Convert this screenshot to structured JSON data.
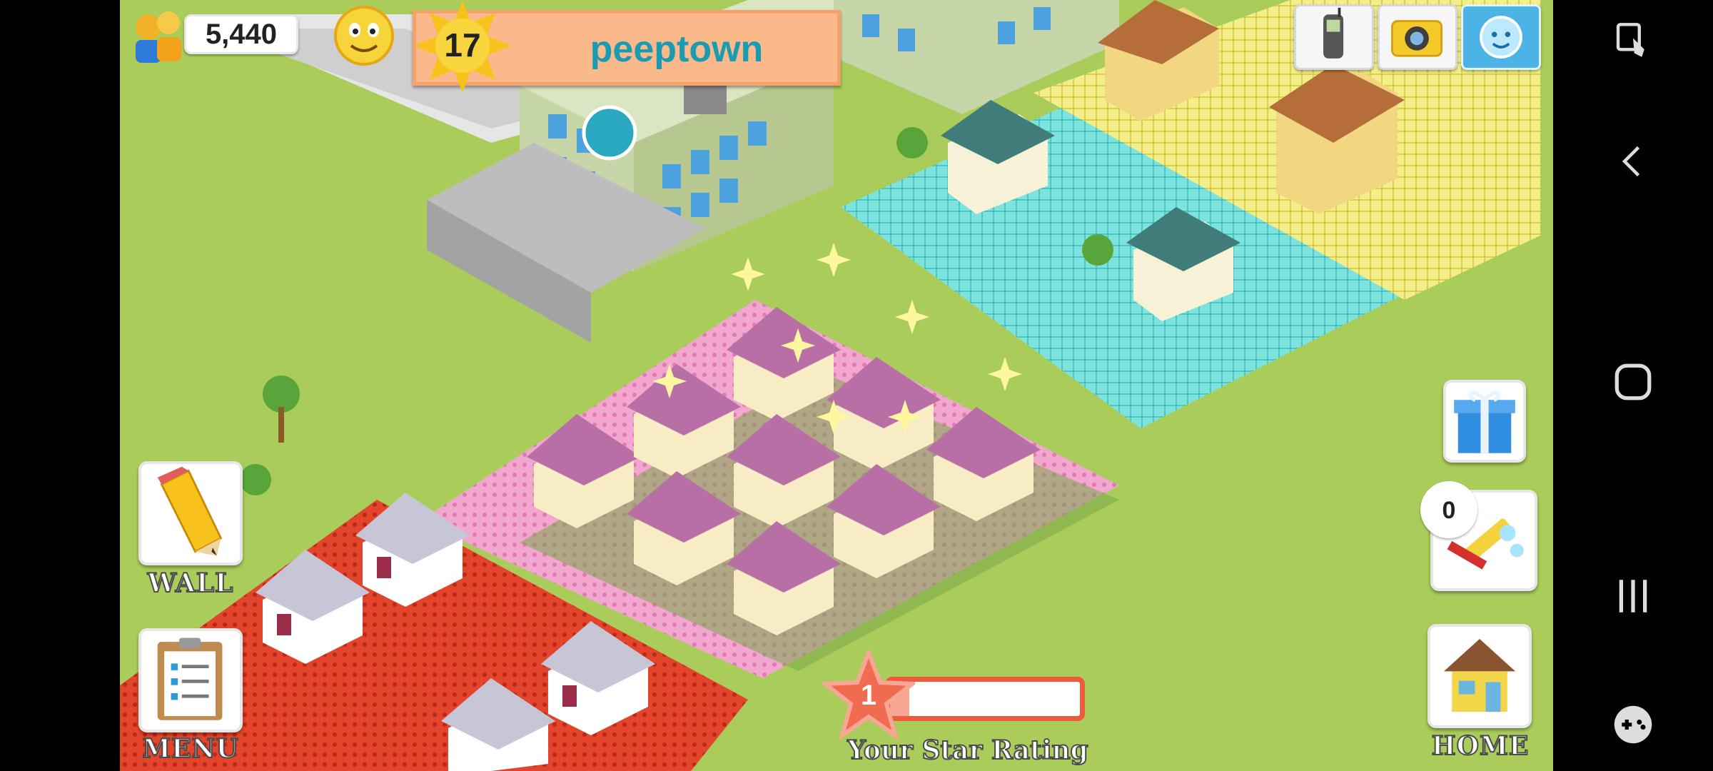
{
  "hud": {
    "population": "5,440",
    "level": "17",
    "town_name": "peeptown",
    "population_icon": "people-coins-icon",
    "mood_icon": "smiley-face-icon",
    "level_icon": "sun-level-icon"
  },
  "toolbar_top": {
    "phone_icon": "mobile-phone-icon",
    "camera_icon": "camera-icon",
    "friends_icon": "friend-face-icon"
  },
  "left_buttons": {
    "wall_label": "WALL",
    "wall_icon": "pencil-icon",
    "menu_label": "MENU",
    "menu_icon": "clipboard-icon"
  },
  "right_buttons": {
    "gift_icon": "gift-box-icon",
    "clean_count": "0",
    "clean_icon": "cleaning-sponge-icon",
    "home_label": "HOME",
    "home_icon": "house-icon"
  },
  "star_rating": {
    "value": "1",
    "label": "Your Star Rating",
    "progress": 0.1
  },
  "system_nav": {
    "pen_icon": "edge-pen-icon",
    "back_icon": "back-chevron-icon",
    "home_icon": "circle-home-icon",
    "recents_icon": "recents-bars-icon",
    "game_icon": "gamepad-icon"
  },
  "colors": {
    "grass": "#a9cc5a",
    "banner": "#f9b98a",
    "town_name": "#1b9bb1",
    "star_bar_border": "#ef5a3c"
  }
}
